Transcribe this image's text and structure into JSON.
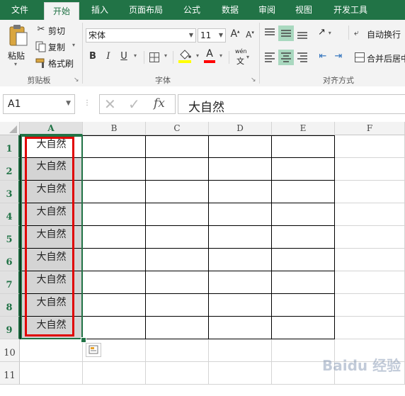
{
  "tabs": [
    {
      "label": "文件",
      "active": false
    },
    {
      "label": "开始",
      "active": true
    },
    {
      "label": "插入",
      "active": false
    },
    {
      "label": "页面布局",
      "active": false
    },
    {
      "label": "公式",
      "active": false
    },
    {
      "label": "数据",
      "active": false
    },
    {
      "label": "审阅",
      "active": false
    },
    {
      "label": "视图",
      "active": false
    },
    {
      "label": "开发工具",
      "active": false
    }
  ],
  "clipboard": {
    "paste": "粘贴",
    "cut": "剪切",
    "copy": "复制",
    "format_painter": "格式刷",
    "group_label": "剪贴板"
  },
  "font": {
    "name": "宋体",
    "size": "11",
    "grow": "A",
    "shrink": "A",
    "bold": "B",
    "italic": "I",
    "underline": "U",
    "font_color": "A",
    "fill_color": "#ffff00",
    "text_color": "#ff0000",
    "phonetic": "wén",
    "phonetic_char": "文",
    "group_label": "字体"
  },
  "alignment": {
    "wrap": "自动换行",
    "merge": "合并后居中",
    "group_label": "对齐方式"
  },
  "formula_bar": {
    "name_box": "A1",
    "fx": "fx",
    "content": "大自然"
  },
  "sheet": {
    "columns": [
      "A",
      "B",
      "C",
      "D",
      "E",
      "F"
    ],
    "rows": [
      "1",
      "2",
      "3",
      "4",
      "5",
      "6",
      "7",
      "8",
      "9",
      "10",
      "11"
    ],
    "cell_text": "大自然",
    "selected_column": "A",
    "accent": "#217346",
    "highlight_border": "#e00000",
    "selection_fill": "#d4d4d4"
  },
  "watermark": "Baidu 经验"
}
